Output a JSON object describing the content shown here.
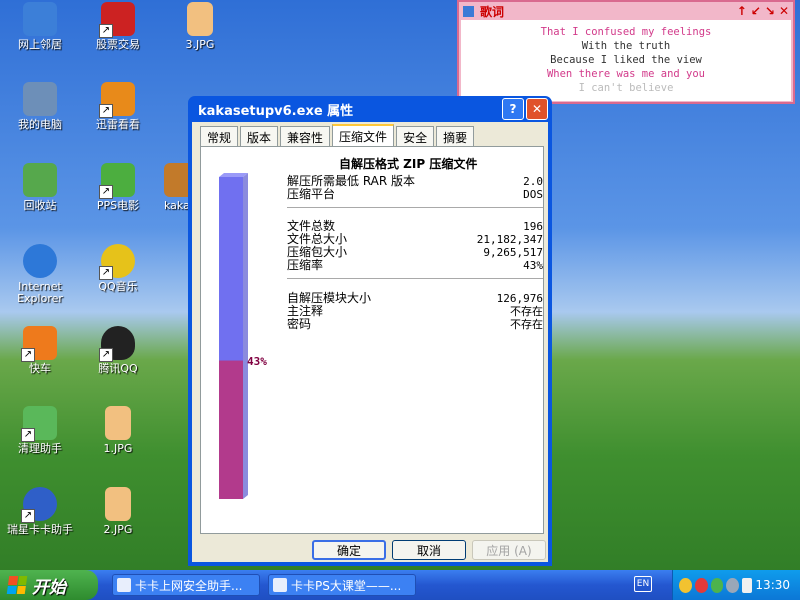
{
  "desktop_icons": [
    {
      "label": "网上邻居",
      "icon": "network-icon",
      "color": "#3c7fd8"
    },
    {
      "label": "股票交易",
      "icon": "stock-trade-icon",
      "color": "#cc2222"
    },
    {
      "label": "3.JPG",
      "icon": "jpg-file-icon",
      "color": "#f2c080"
    },
    {
      "label": "我的电脑",
      "icon": "computer-icon",
      "color": "#6d8fb8"
    },
    {
      "label": "迅雷看看",
      "icon": "xunlei-kankan-icon",
      "color": "#e88a1a"
    },
    {
      "label": "回收站",
      "icon": "recycle-bin-icon",
      "color": "#56a84c"
    },
    {
      "label": "PPS电影",
      "icon": "pps-icon",
      "color": "#4cae3f"
    },
    {
      "label": "kaka",
      "icon": "kaka-icon",
      "color": "#c27a2a"
    },
    {
      "label": "Internet Explorer",
      "icon": "ie-icon",
      "color": "#2d78d8"
    },
    {
      "label": "QQ音乐",
      "icon": "qq-music-icon",
      "color": "#e6c21a"
    },
    {
      "label": "快车",
      "icon": "flashget-icon",
      "color": "#ee7a1c"
    },
    {
      "label": "腾讯QQ",
      "icon": "qq-penguin-icon",
      "color": "#222222"
    },
    {
      "label": "清理助手",
      "icon": "clean-helper-icon",
      "color": "#5ab85a"
    },
    {
      "label": "1.JPG",
      "icon": "jpg-file-icon",
      "color": "#f2c080"
    },
    {
      "label": "瑞星卡卡助手",
      "icon": "rising-kaka-icon",
      "color": "#2f5fc8"
    },
    {
      "label": "2.JPG",
      "icon": "jpg-file-icon",
      "color": "#f2c080"
    }
  ],
  "lyrics": {
    "title": "歌词",
    "controls": [
      "↑",
      "↙",
      "↘",
      "✕"
    ],
    "lines": [
      {
        "text": "That I confused my feelings",
        "style": "pink"
      },
      {
        "text": "With the truth",
        "style": "dark"
      },
      {
        "text": "Because I liked the view",
        "style": "dark"
      },
      {
        "text": "When there was me and you",
        "style": "pink"
      },
      {
        "text": "I can't believe",
        "style": "fade"
      }
    ]
  },
  "dialog": {
    "title": "kakasetupv6.exe 属性",
    "help_label": "?",
    "close_label": "✕",
    "tabs": [
      {
        "label": "常规",
        "active": false
      },
      {
        "label": "版本",
        "active": false
      },
      {
        "label": "兼容性",
        "active": false
      },
      {
        "label": "压缩文件",
        "active": true
      },
      {
        "label": "安全",
        "active": false
      },
      {
        "label": "摘要",
        "active": false
      }
    ],
    "heading": "自解压格式 ZIP 压缩文件",
    "group1": [
      {
        "label": "解压所需最低 RAR 版本",
        "value": "2.0"
      },
      {
        "label": "压缩平台",
        "value": "DOS"
      }
    ],
    "group2": [
      {
        "label": "文件总数",
        "value": "196"
      },
      {
        "label": "文件总大小",
        "value": "21,182,347"
      },
      {
        "label": "压缩包大小",
        "value": "9,265,517"
      },
      {
        "label": "压缩率",
        "value": "43%"
      }
    ],
    "group3": [
      {
        "label": "自解压模块大小",
        "value": "126,976"
      },
      {
        "label": "主注释",
        "value": "不存在"
      },
      {
        "label": "密码",
        "value": "不存在"
      }
    ],
    "ratio": {
      "value": 0.43,
      "label": "43%",
      "fill_color": "#b23a8c",
      "empty_color": "#7070f0"
    },
    "buttons": {
      "ok": "确定",
      "cancel": "取消",
      "apply": "应用 (A)"
    }
  },
  "taskbar": {
    "start_label": "开始",
    "tasks": [
      "卡卡上网安全助手...",
      "卡卡PS大课堂——..."
    ],
    "keyboard_label": "EN",
    "clock": "13:30"
  }
}
